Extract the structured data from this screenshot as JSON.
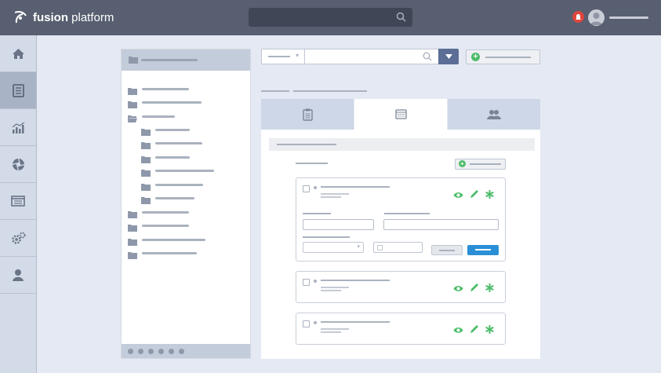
{
  "app": {
    "brand_bold": "fusion",
    "brand_rest": " platform"
  },
  "topbar": {
    "search_icon": "search-icon",
    "notification_icon": "bell-icon",
    "avatar_icon": "user-avatar-icon"
  },
  "leftnav": {
    "items": [
      {
        "icon": "home-icon",
        "active": false
      },
      {
        "icon": "document-icon",
        "active": true
      },
      {
        "icon": "analytics-icon",
        "active": false
      },
      {
        "icon": "aperture-icon",
        "active": false
      },
      {
        "icon": "list-window-icon",
        "active": false
      },
      {
        "icon": "gears-icon",
        "active": false
      },
      {
        "icon": "user-icon",
        "active": false
      }
    ]
  },
  "tabs": [
    {
      "icon": "clipboard-icon",
      "active": false
    },
    {
      "icon": "calculator-icon",
      "active": true
    },
    {
      "icon": "users-icon",
      "active": false
    }
  ],
  "cards": [
    {
      "actions": [
        "eye-icon",
        "pencil-icon",
        "asterisk-icon"
      ]
    },
    {
      "actions": [
        "eye-icon",
        "pencil-icon",
        "asterisk-icon"
      ]
    },
    {
      "actions": [
        "eye-icon",
        "pencil-icon",
        "asterisk-icon"
      ]
    }
  ],
  "colors": {
    "topbar": "#575f70",
    "accent_blue": "#2a8fd6",
    "action_green": "#4dbd6a",
    "alert_red": "#e0453d",
    "dropdown_blue": "#5c6e95"
  }
}
